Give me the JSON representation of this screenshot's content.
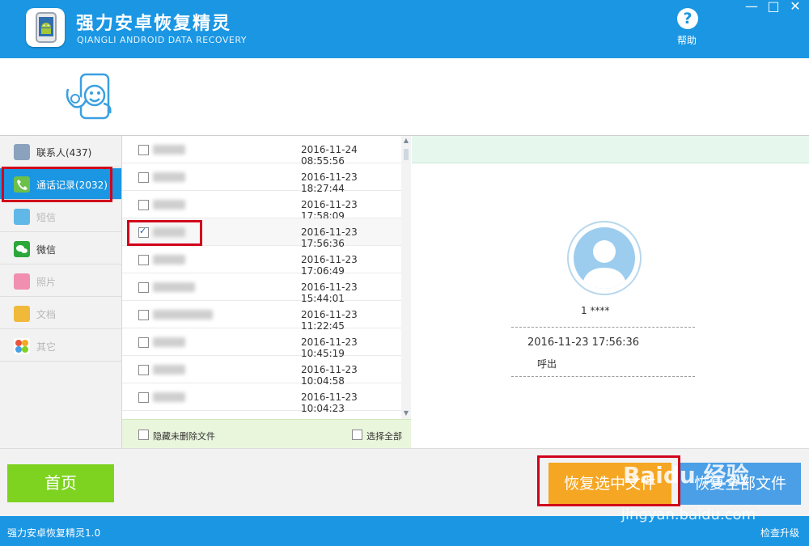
{
  "app": {
    "title": "强力安卓恢复精灵",
    "subtitle": "QIANGLI ANDROID DATA RECOVERY",
    "help_label": "帮助",
    "window_controls": [
      "—",
      "□",
      "✕"
    ]
  },
  "sidebar": {
    "items": [
      {
        "label": "联系人(437)",
        "icon": "contacts-icon",
        "color": "#8aa2bd",
        "state": "normal"
      },
      {
        "label": "通话记录(2032)",
        "icon": "phone-icon",
        "color": "#6cc04a",
        "state": "active"
      },
      {
        "label": "短信",
        "icon": "sms-icon",
        "color": "#5fb8e8",
        "state": "dim"
      },
      {
        "label": "微信",
        "icon": "wechat-icon",
        "color": "#2aa83a",
        "state": "normal"
      },
      {
        "label": "照片",
        "icon": "photo-icon",
        "color": "#f08fb0",
        "state": "dim"
      },
      {
        "label": "文档",
        "icon": "document-icon",
        "color": "#f0b93a",
        "state": "dim"
      },
      {
        "label": "其它",
        "icon": "other-icon",
        "color": "#e8543e",
        "state": "dim"
      }
    ]
  },
  "list": {
    "rows": [
      {
        "datetime": "2016-11-24 08:55:56",
        "checked": false
      },
      {
        "datetime": "2016-11-23 18:27:44",
        "checked": false
      },
      {
        "datetime": "2016-11-23 17:58:09",
        "checked": false
      },
      {
        "datetime": "2016-11-23 17:56:36",
        "checked": true
      },
      {
        "datetime": "2016-11-23 17:06:49",
        "checked": false
      },
      {
        "datetime": "2016-11-23 15:44:01",
        "checked": false
      },
      {
        "datetime": "2016-11-23 11:22:45",
        "checked": false
      },
      {
        "datetime": "2016-11-23 10:45:19",
        "checked": false
      },
      {
        "datetime": "2016-11-23 10:04:58",
        "checked": false
      },
      {
        "datetime": "2016-11-23 10:04:23",
        "checked": false
      }
    ],
    "hide_undeleted_label": "隐藏未删除文件",
    "select_all_label": "选择全部"
  },
  "detail": {
    "number": "1        ****",
    "call_time": "2016-11-23 17:56:36",
    "call_type": "呼出"
  },
  "actions": {
    "home": "首页",
    "restore_selected": "恢复选中文件",
    "restore_all": "恢复全部文件"
  },
  "status": {
    "version": "强力安卓恢复精灵1.0",
    "upgrade": "检查升级"
  },
  "watermark": {
    "text": "Baidu 经验",
    "url": "jingyan.baidu.com"
  },
  "colors": {
    "brand_blue": "#1a96e3",
    "home_green": "#7ed321",
    "restore_orange": "#f5a623",
    "highlight_red": "#d0021b"
  }
}
